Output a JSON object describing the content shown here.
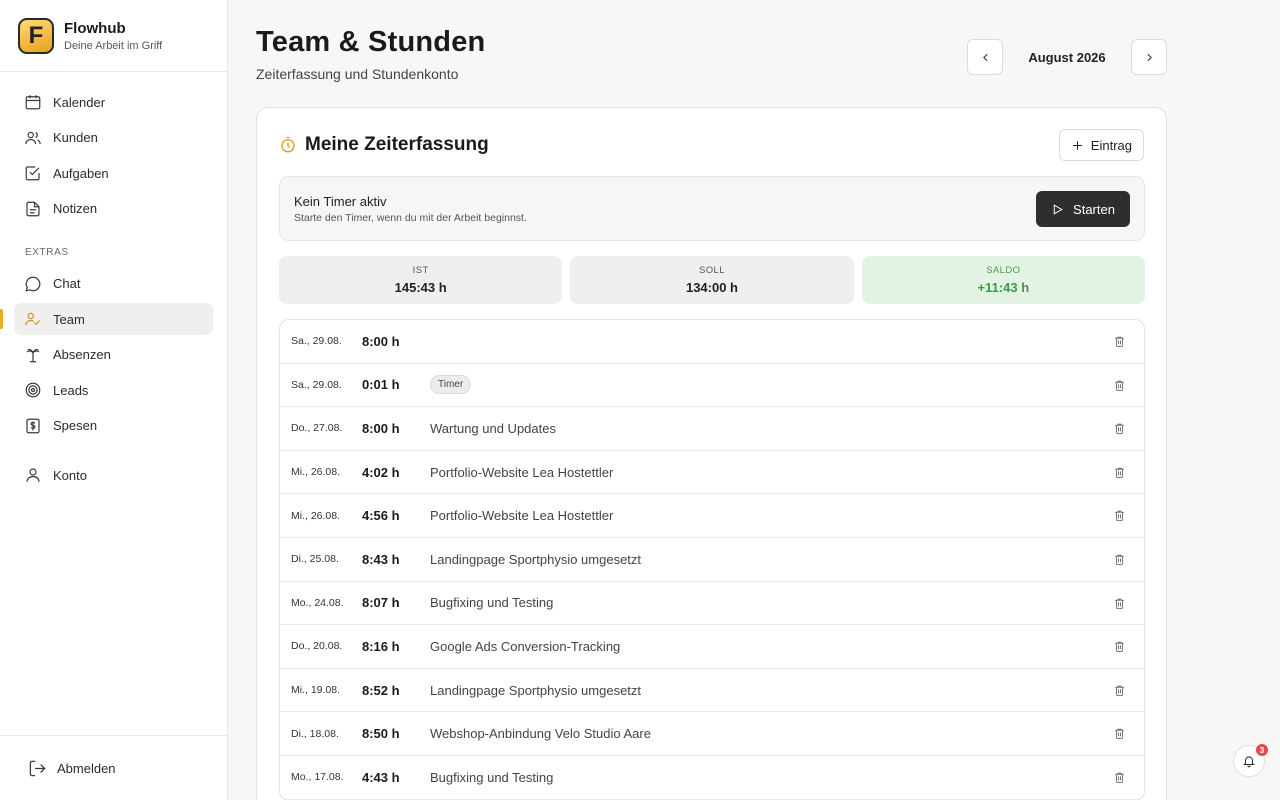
{
  "brand": {
    "logo_letter": "F",
    "name": "Flowhub",
    "tagline": "Deine Arbeit im Griff"
  },
  "sidebar": {
    "main_items": [
      {
        "label": "Kalender",
        "icon": "calendar-icon"
      },
      {
        "label": "Kunden",
        "icon": "users-icon"
      },
      {
        "label": "Aufgaben",
        "icon": "checkbox-icon"
      },
      {
        "label": "Notizen",
        "icon": "note-icon"
      }
    ],
    "extras_label": "EXTRAS",
    "extras_items": [
      {
        "label": "Chat",
        "icon": "chat-icon"
      },
      {
        "label": "Team",
        "icon": "team-icon",
        "active": true
      },
      {
        "label": "Absenzen",
        "icon": "palm-tree-icon"
      },
      {
        "label": "Leads",
        "icon": "target-icon"
      },
      {
        "label": "Spesen",
        "icon": "receipt-icon"
      }
    ],
    "account_item": {
      "label": "Konto",
      "icon": "user-icon"
    },
    "logout_label": "Abmelden"
  },
  "header": {
    "title": "Team & Stunden",
    "subtitle": "Zeiterfassung und Stundenkonto",
    "month": "August 2026"
  },
  "card": {
    "title": "Meine Zeiterfassung",
    "add_label": "Eintrag",
    "timer": {
      "title": "Kein Timer aktiv",
      "subtitle": "Starte den Timer, wenn du mit der Arbeit beginnst.",
      "start_label": "Starten"
    },
    "stats": {
      "ist_label": "IST",
      "ist_value": "145:43 h",
      "soll_label": "SOLL",
      "soll_value": "134:00 h",
      "saldo_label": "SALDO",
      "saldo_value": "+11:43 h"
    },
    "entries": [
      {
        "date": "Sa., 29.08.",
        "hours": "8:00 h",
        "desc": ""
      },
      {
        "date": "Sa., 29.08.",
        "hours": "0:01 h",
        "tag": "Timer"
      },
      {
        "date": "Do., 27.08.",
        "hours": "8:00 h",
        "desc": "Wartung und Updates"
      },
      {
        "date": "Mi., 26.08.",
        "hours": "4:02 h",
        "desc": "Portfolio-Website Lea Hostettler"
      },
      {
        "date": "Mi., 26.08.",
        "hours": "4:56 h",
        "desc": "Portfolio-Website Lea Hostettler"
      },
      {
        "date": "Di., 25.08.",
        "hours": "8:43 h",
        "desc": "Landingpage Sportphysio umgesetzt"
      },
      {
        "date": "Mo., 24.08.",
        "hours": "8:07 h",
        "desc": "Bugfixing und Testing"
      },
      {
        "date": "Do., 20.08.",
        "hours": "8:16 h",
        "desc": "Google Ads Conversion-Tracking"
      },
      {
        "date": "Mi., 19.08.",
        "hours": "8:52 h",
        "desc": "Landingpage Sportphysio umgesetzt"
      },
      {
        "date": "Di., 18.08.",
        "hours": "8:50 h",
        "desc": "Webshop-Anbindung Velo Studio Aare"
      },
      {
        "date": "Mo., 17.08.",
        "hours": "4:43 h",
        "desc": "Bugfixing und Testing"
      }
    ]
  },
  "notifications": {
    "count": "3",
    "icon": "bell-icon"
  },
  "colors": {
    "accent": "#e6b021",
    "saldo_green": "#3e9a48",
    "start_button": "#2e2e2e"
  }
}
